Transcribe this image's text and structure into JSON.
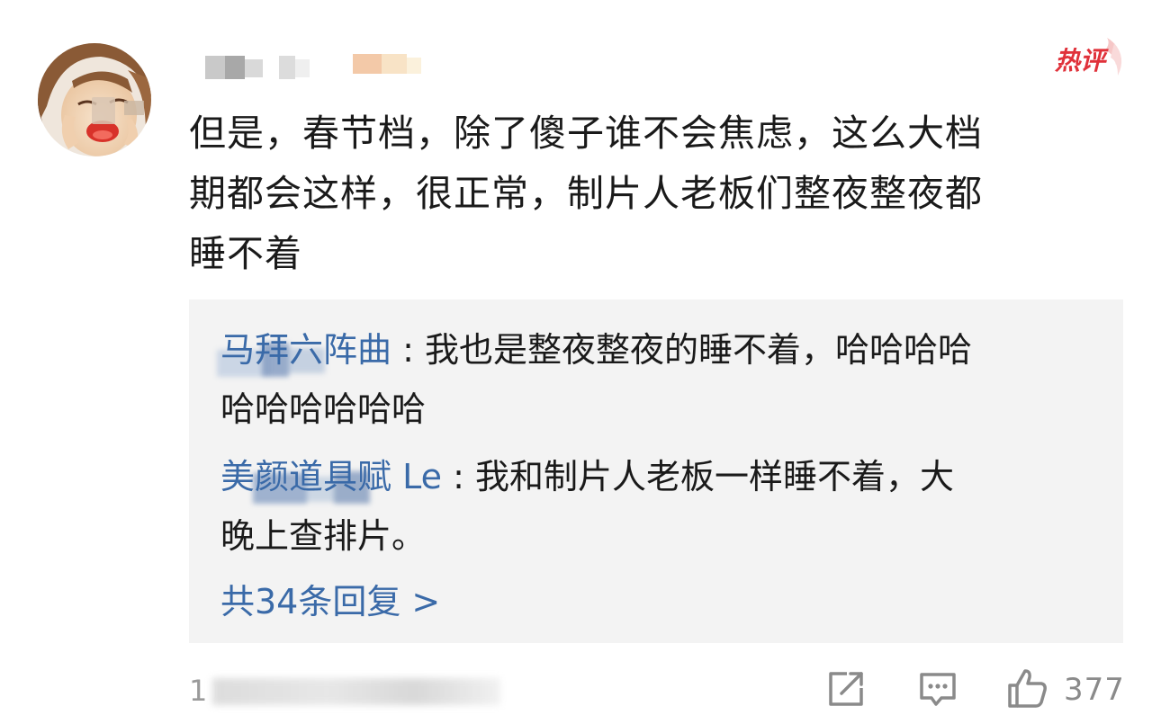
{
  "comment": {
    "badge": "热评",
    "text_lines": [
      "但是，春节档，除了傻子谁不会焦虑，这么大档",
      "期都会这样，很正常，制片人老板们整夜整夜都",
      "睡不着"
    ]
  },
  "replies": [
    {
      "name": "马拜六阵曲",
      "separator": ": ",
      "line1": "我也是整夜整夜的睡不着，哈哈哈哈",
      "line2": "哈哈哈哈哈哈"
    },
    {
      "name": "美颜道具赋 Le",
      "separator": ": ",
      "line1": "我和制片人老板一样睡不着，大",
      "line2": "晚上查排片。"
    }
  ],
  "more_replies": "共34条回复 >",
  "footer": {
    "time_prefix": "1",
    "like_count": "377"
  },
  "colors": {
    "link_blue": "#3a6aa8",
    "hot_red": "#e0313a",
    "reply_bg": "#f3f3f3",
    "icon_gray": "#8a8a8a"
  }
}
